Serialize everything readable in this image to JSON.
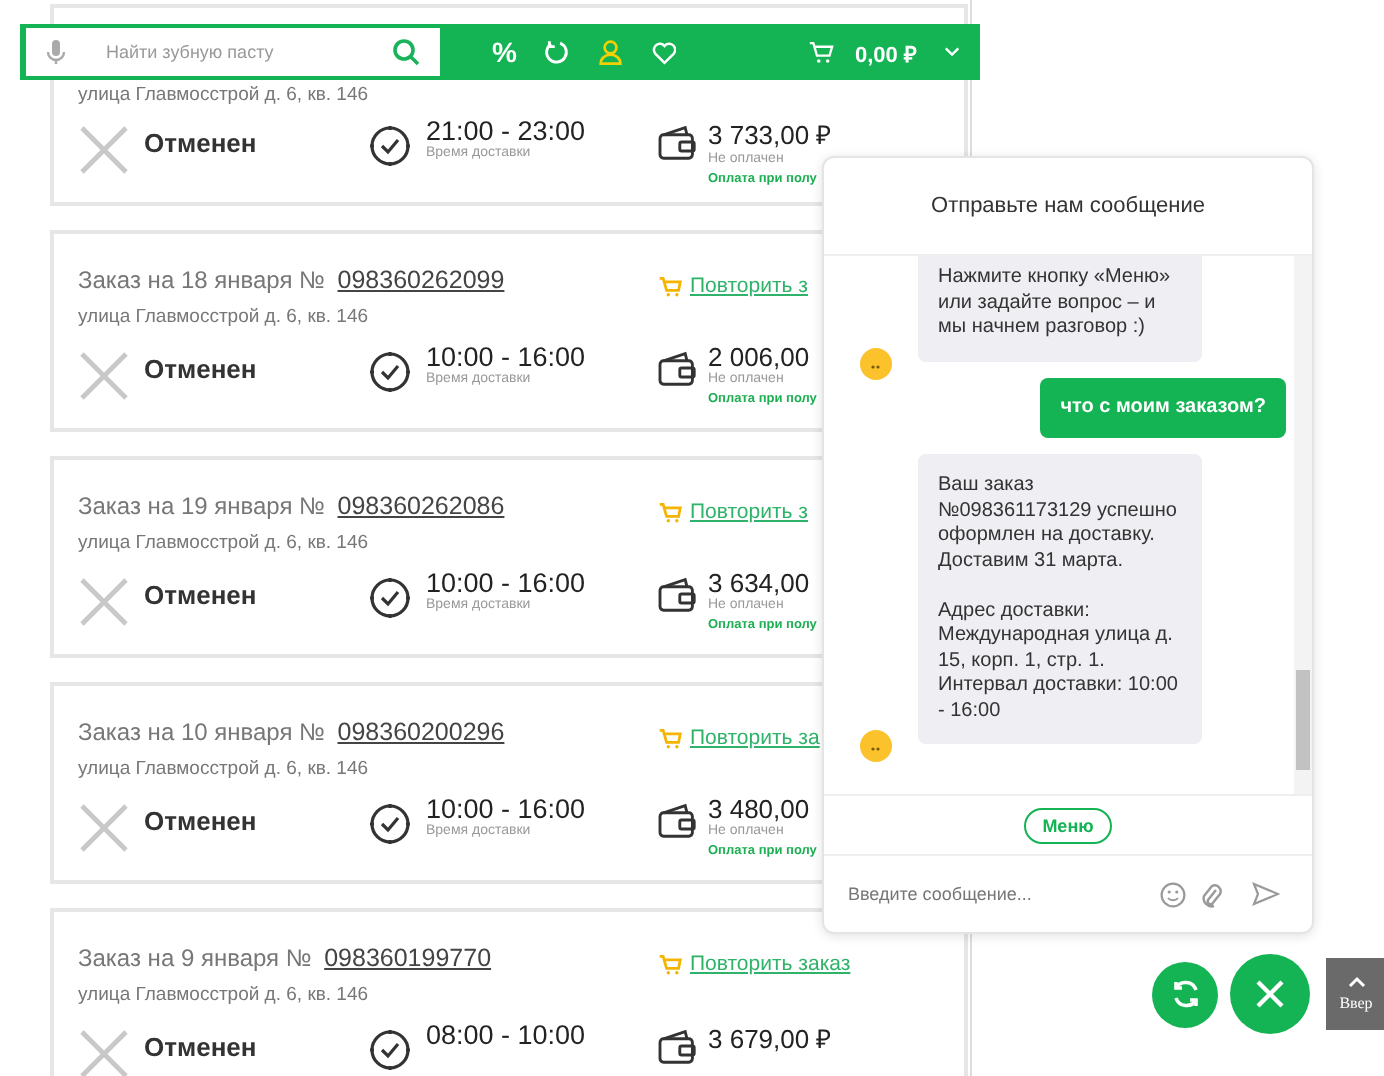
{
  "header": {
    "search": {
      "placeholder": "Найти зубную пасту"
    },
    "discount_label": "%",
    "cart_total": "0,00 ₽"
  },
  "orders": [
    {
      "address": "улица Главмосстрой д. 6, кв. 146",
      "status": "Отменен",
      "time": "21:00 - 23:00",
      "time_label": "Время доставки",
      "amount": "3 733,00 ₽",
      "paid_label": "Не оплачен",
      "payment": "Оплата при полу"
    },
    {
      "title": "Заказ на 18 января №",
      "number": "098360262099",
      "repeat": "Повторить з",
      "address": "улица Главмосстрой д. 6, кв. 146",
      "status": "Отменен",
      "time": "10:00 - 16:00",
      "time_label": "Время доставки",
      "amount": "2 006,00",
      "paid_label": "Не оплачен",
      "payment": "Оплата при полу"
    },
    {
      "title": "Заказ на 19 января №",
      "number": "098360262086",
      "repeat": "Повторить з",
      "address": "улица Главмосстрой д. 6, кв. 146",
      "status": "Отменен",
      "time": "10:00 - 16:00",
      "time_label": "Время доставки",
      "amount": "3 634,00",
      "paid_label": "Не оплачен",
      "payment": "Оплата при полу"
    },
    {
      "title": "Заказ на 10 января №",
      "number": "098360200296",
      "repeat": "Повторить за",
      "address": "улица Главмосстрой д. 6, кв. 146",
      "status": "Отменен",
      "time": "10:00 - 16:00",
      "time_label": "Время доставки",
      "amount": "3 480,00",
      "paid_label": "Не оплачен",
      "payment": "Оплата при полу"
    },
    {
      "title": "Заказ на 9 января №",
      "number": "098360199770",
      "repeat": "Повторить заказ",
      "address": "улица Главмосстрой д. 6, кв. 146",
      "status": "Отменен",
      "time": "08:00 - 10:00",
      "amount": "3 679,00 ₽"
    }
  ],
  "chat": {
    "title": "Отправьте нам сообщение",
    "messages": [
      {
        "kind": "bot",
        "text": "Нажмите кнопку «Меню» или задайте вопрос – и мы начнем разговор :)"
      },
      {
        "kind": "user",
        "text": "что с моим заказом?"
      },
      {
        "kind": "bot",
        "text": "Ваш заказ №098361173129 успешно оформлен на доставку. Доставим 31 марта.\n\nАдрес доставки: Международная улица д. 15, корп. 1, стр. 1. Интервал доставки: 10:00 - 16:00"
      }
    ],
    "menu_button": "Меню",
    "input": {
      "placeholder": "Введите сообщение..."
    }
  },
  "scroll_top_label": "Ввер"
}
